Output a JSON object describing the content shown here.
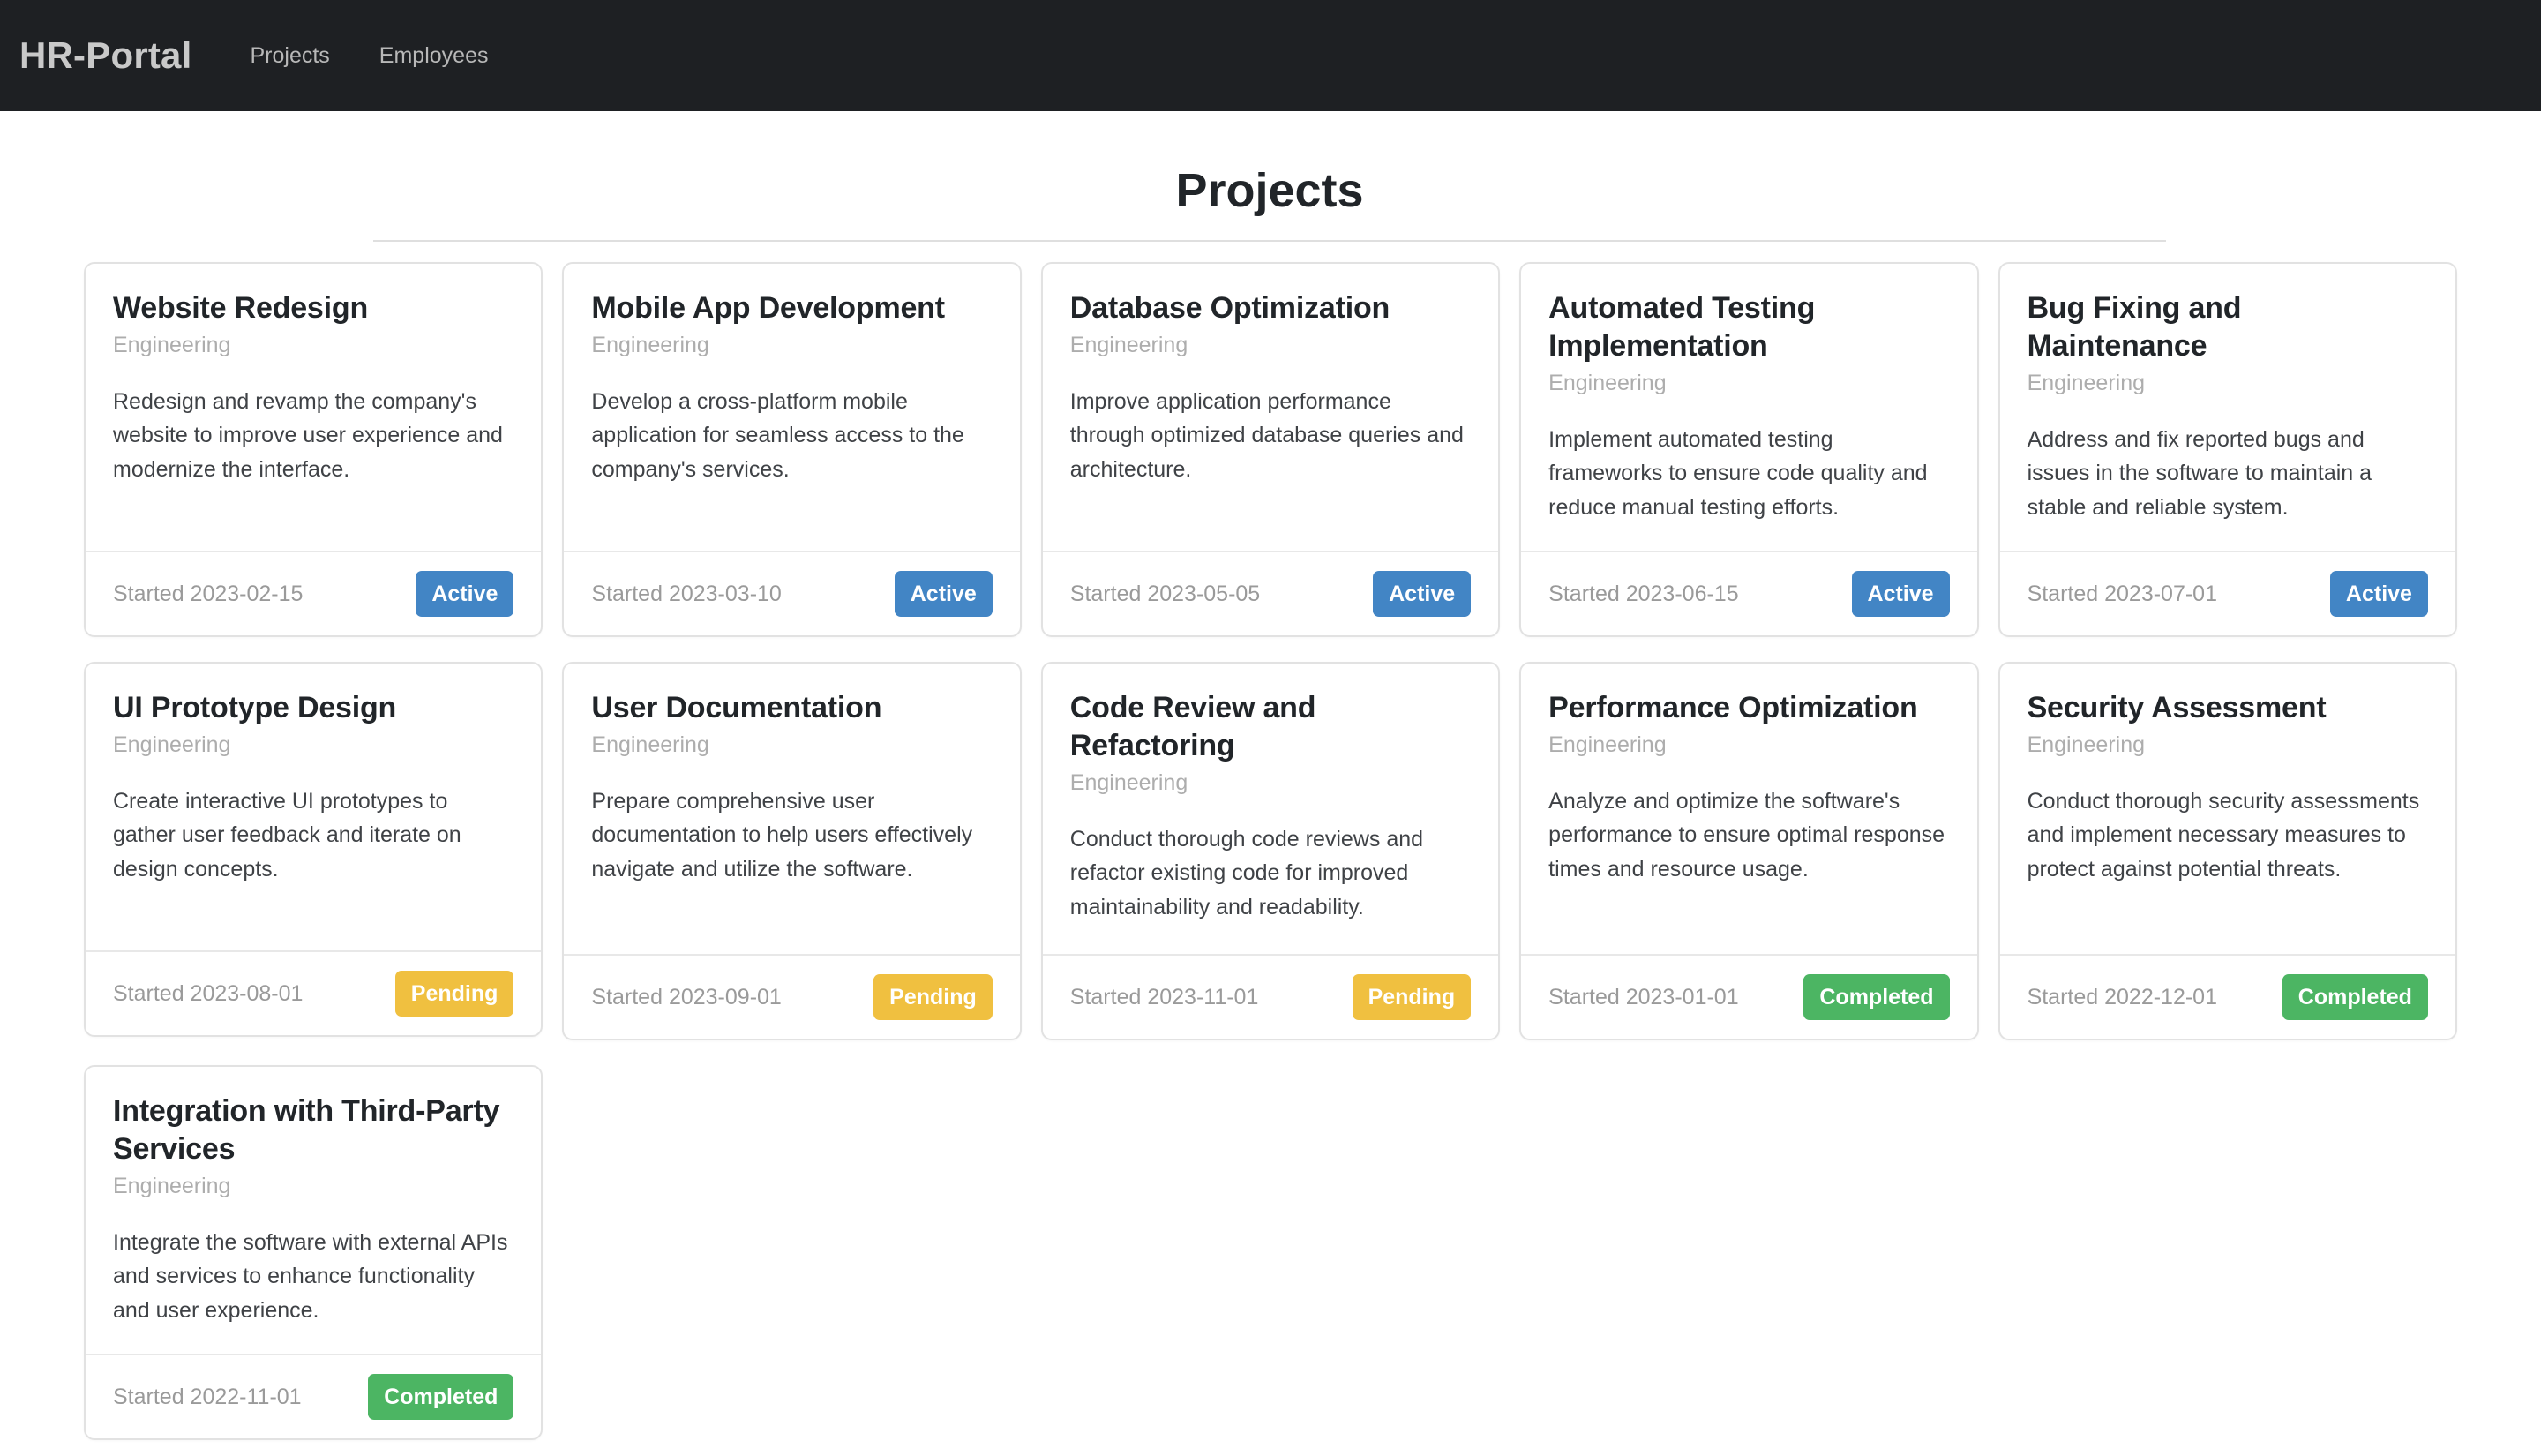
{
  "navbar": {
    "brand": "HR-Portal",
    "links": [
      {
        "label": "Projects"
      },
      {
        "label": "Employees"
      }
    ]
  },
  "page": {
    "title": "Projects"
  },
  "labels": {
    "started_prefix": "Started"
  },
  "status_colors": {
    "Active": "#4285c5",
    "Pending": "#f0c040",
    "Completed": "#4cb563"
  },
  "projects": [
    {
      "title": "Website Redesign",
      "department": "Engineering",
      "description": "Redesign and revamp the company's website to improve user experience and modernize the interface.",
      "started": "Started 2023-02-15",
      "status": "Active"
    },
    {
      "title": "Mobile App Development",
      "department": "Engineering",
      "description": "Develop a cross-platform mobile application for seamless access to the company's services.",
      "started": "Started 2023-03-10",
      "status": "Active"
    },
    {
      "title": "Database Optimization",
      "department": "Engineering",
      "description": "Improve application performance through optimized database queries and architecture.",
      "started": "Started 2023-05-05",
      "status": "Active"
    },
    {
      "title": "Automated Testing Implementation",
      "department": "Engineering",
      "description": "Implement automated testing frameworks to ensure code quality and reduce manual testing efforts.",
      "started": "Started 2023-06-15",
      "status": "Active"
    },
    {
      "title": "Bug Fixing and Maintenance",
      "department": "Engineering",
      "description": "Address and fix reported bugs and issues in the software to maintain a stable and reliable system.",
      "started": "Started 2023-07-01",
      "status": "Active"
    },
    {
      "title": "UI Prototype Design",
      "department": "Engineering",
      "description": "Create interactive UI prototypes to gather user feedback and iterate on design concepts.",
      "started": "Started 2023-08-01",
      "status": "Pending"
    },
    {
      "title": "User Documentation",
      "department": "Engineering",
      "description": "Prepare comprehensive user documentation to help users effectively navigate and utilize the software.",
      "started": "Started 2023-09-01",
      "status": "Pending"
    },
    {
      "title": "Code Review and Refactoring",
      "department": "Engineering",
      "description": "Conduct thorough code reviews and refactor existing code for improved maintainability and readability.",
      "started": "Started 2023-11-01",
      "status": "Pending"
    },
    {
      "title": "Performance Optimization",
      "department": "Engineering",
      "description": "Analyze and optimize the software's performance to ensure optimal response times and resource usage.",
      "started": "Started 2023-01-01",
      "status": "Completed"
    },
    {
      "title": "Security Assessment",
      "department": "Engineering",
      "description": "Conduct thorough security assessments and implement necessary measures to protect against potential threats.",
      "started": "Started 2022-12-01",
      "status": "Completed"
    },
    {
      "title": "Integration with Third-Party Services",
      "department": "Engineering",
      "description": "Integrate the software with external APIs and services to enhance functionality and user experience.",
      "started": "Started 2022-11-01",
      "status": "Completed"
    }
  ]
}
